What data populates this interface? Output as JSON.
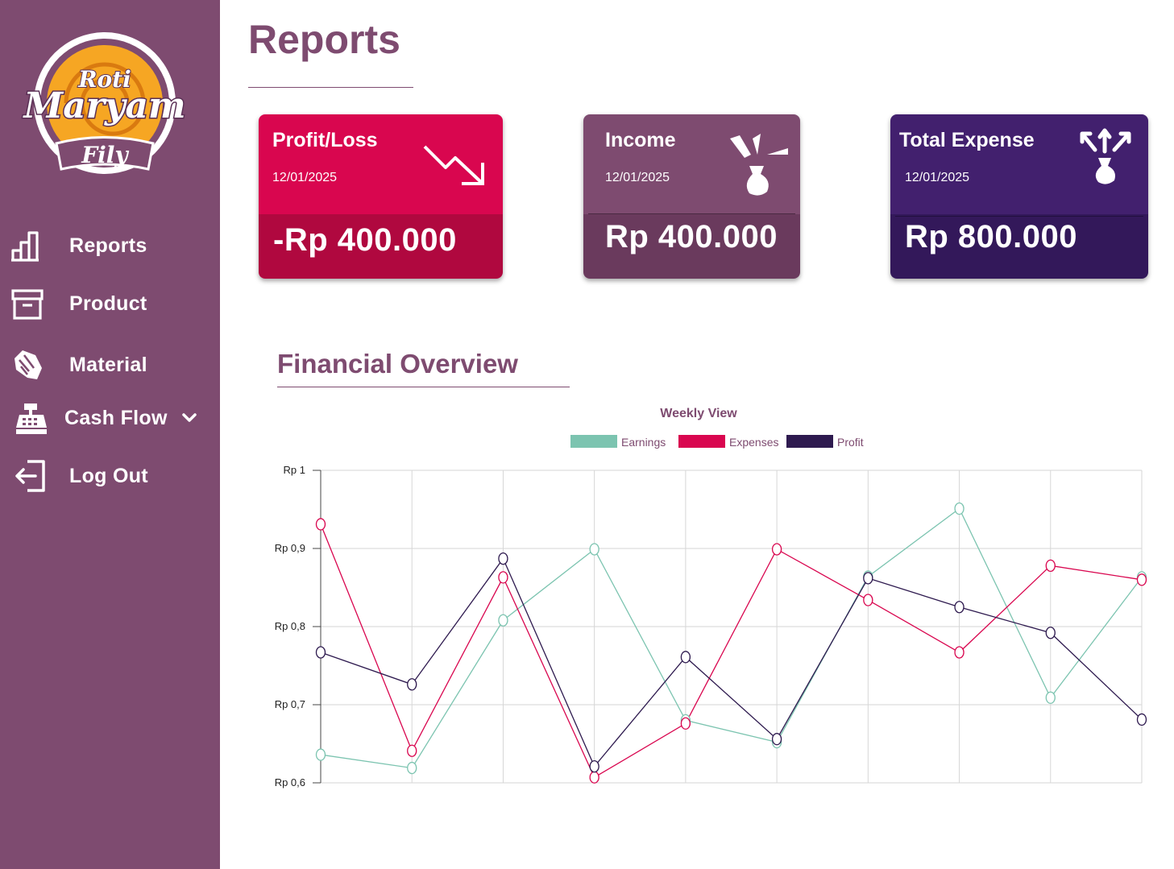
{
  "brand": {
    "line1": "Roti",
    "line2": "Maryam",
    "line3": "Fily"
  },
  "sidebar": {
    "items": [
      {
        "label": "Reports",
        "icon": "bar-chart-icon"
      },
      {
        "label": "Product",
        "icon": "archive-box-icon"
      },
      {
        "label": "Material",
        "icon": "wheat-bag-icon"
      },
      {
        "label": "Cash Flow",
        "icon": "cash-register-icon",
        "has_dropdown": true
      },
      {
        "label": "Log Out",
        "icon": "logout-icon"
      }
    ]
  },
  "main": {
    "title": "Reports"
  },
  "cards": [
    {
      "title": "Profit/Loss",
      "date": "12/01/2025",
      "value": "-Rp 400.000",
      "icon": "trend-down-icon",
      "color_top": "#d9064f",
      "color_bottom": "#b0083f"
    },
    {
      "title": "Income",
      "date": "12/01/2025",
      "value": "Rp 400.000",
      "icon": "money-bag-in-icon",
      "color_top": "#7e4b70",
      "color_bottom": "#6a3a5d"
    },
    {
      "title": "Total Expense",
      "date": "12/01/2025",
      "value": "Rp 800.000",
      "icon": "money-bag-out-icon",
      "color_top": "#42206e",
      "color_bottom": "#33185a"
    }
  ],
  "section": {
    "title": "Financial Overview"
  },
  "chart_data": {
    "type": "line",
    "title": "Weekly View",
    "y_ticks": [
      "Rp 1",
      "Rp 0,9",
      "Rp 0,8",
      "Rp 0,7",
      "Rp 0,6"
    ],
    "ylim": [
      0.6,
      1.0
    ],
    "grid": true,
    "legend": "top-center",
    "x_count": 10,
    "series": [
      {
        "name": "Earnings",
        "color": "#7cc4b0",
        "values": [
          0.636,
          0.619,
          0.808,
          0.899,
          0.68,
          0.652,
          0.864,
          0.951,
          0.709,
          0.863
        ]
      },
      {
        "name": "Expenses",
        "color": "#d9064f",
        "values": [
          0.931,
          0.641,
          0.863,
          0.607,
          0.676,
          0.899,
          0.834,
          0.767,
          0.878,
          0.86
        ]
      },
      {
        "name": "Profit",
        "color": "#2e1a4f",
        "values": [
          0.767,
          0.726,
          0.887,
          0.621,
          0.761,
          0.656,
          0.862,
          0.825,
          0.792,
          0.681
        ]
      }
    ]
  }
}
